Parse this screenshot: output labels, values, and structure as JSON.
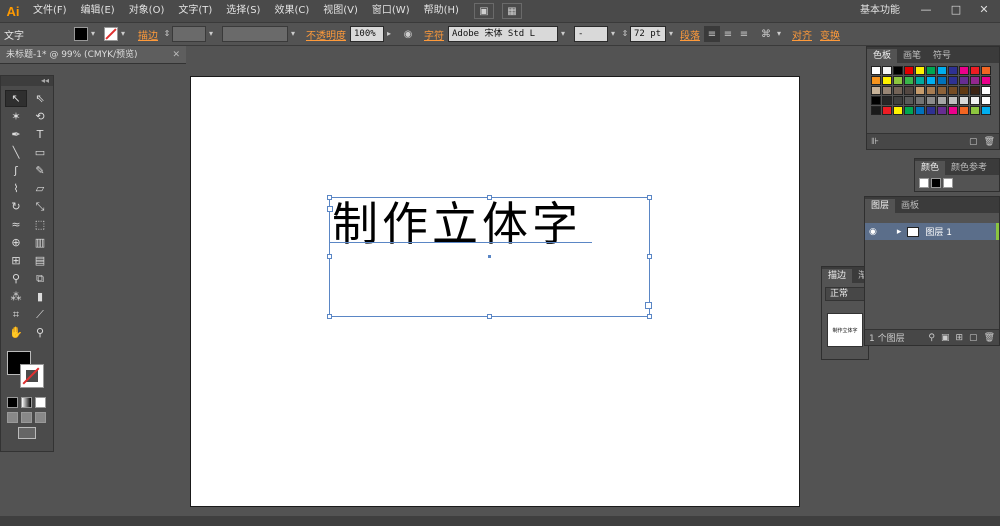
{
  "app": {
    "logo": "Ai"
  },
  "menu": [
    "文件(F)",
    "编辑(E)",
    "对象(O)",
    "文字(T)",
    "选择(S)",
    "效果(C)",
    "视图(V)",
    "窗口(W)",
    "帮助(H)"
  ],
  "workspace": "基本功能",
  "window_controls": [
    "—",
    "□",
    "✕"
  ],
  "control_bar": {
    "mode_label": "文字",
    "stroke_label": "描边",
    "opacity_label": "不透明度",
    "opacity_value": "100%",
    "char_label": "字符",
    "font_family": "Adobe 宋体 Std L",
    "font_style": "-",
    "font_size": "72 pt",
    "para_label": "段落",
    "align_label": "对齐",
    "transform_label": "变换"
  },
  "document_tab": {
    "title": "未标题-1* @ 99% (CMYK/预览)",
    "close": "✕"
  },
  "artboard": {
    "text": "制作立体字"
  },
  "panels": {
    "swatches": {
      "tabs": [
        "色板",
        "画笔",
        "符号"
      ]
    },
    "color": {
      "tabs": [
        "颜色",
        "颜色参考"
      ]
    },
    "stroke": {
      "tabs": [
        "描边",
        "渐"
      ],
      "blend_mode": "正常",
      "thumb_text": "制作立体字"
    },
    "layers": {
      "tabs": [
        "图层",
        "画板"
      ],
      "layer_name": "图层 1",
      "footer_text": "1 个图层"
    }
  },
  "colors": {
    "accent": "#ff9a3a",
    "selection": "#5a86c5",
    "swatches": [
      "#ffffff",
      "#f4f4f4",
      "#000000",
      "#e10000",
      "#fff200",
      "#00a651",
      "#00aeef",
      "#2e3192",
      "#ec008c",
      "#ed1c24",
      "#f26522",
      "#f7941d",
      "#fff200",
      "#8dc63f",
      "#39b54a",
      "#00a99d",
      "#00aeef",
      "#0072bc",
      "#2e3192",
      "#662d91",
      "#92278f",
      "#ec008c",
      "#c7b299",
      "#998675",
      "#736357",
      "#534741",
      "#c69c6d",
      "#a67c52",
      "#8c6239",
      "#754c24",
      "#603913",
      "#3c2415",
      "#ffffff",
      "#000000",
      "#262626",
      "#404040",
      "#595959",
      "#737373",
      "#8c8c8c",
      "#a6a6a6",
      "#bfbfbf",
      "#d9d9d9",
      "#f2f2f2",
      "#ffffff",
      "#1a1a1a",
      "#ed1c24",
      "#fff200",
      "#00a651",
      "#0072bc",
      "#2e3192",
      "#662d91",
      "#ec008c",
      "#f26522",
      "#8dc63f",
      "#00aeef"
    ]
  }
}
